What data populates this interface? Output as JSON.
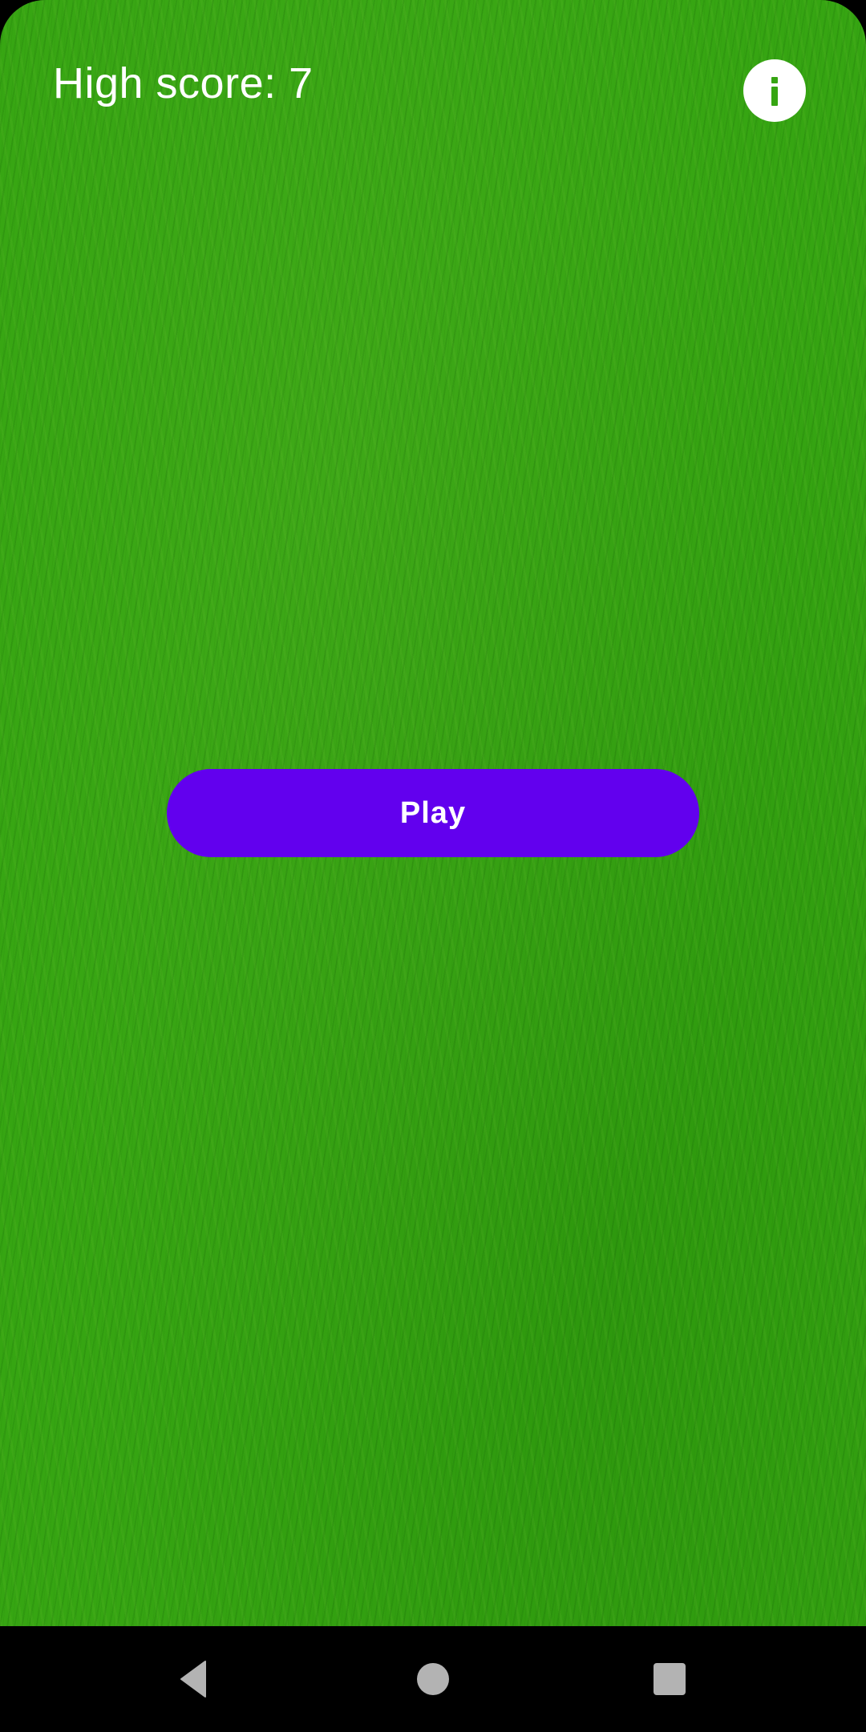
{
  "game": {
    "high_score_text": "High score: 7",
    "high_score_value": 7,
    "play_label": "Play",
    "info_icon": "info-icon"
  },
  "colors": {
    "grass": "#36a512",
    "play_button": "#6200ee",
    "text": "#ffffff",
    "nav_bar": "#000000",
    "nav_icon": "#b3b3b3"
  },
  "nav": {
    "back_icon": "back-triangle-icon",
    "home_icon": "home-circle-icon",
    "recents_icon": "recents-square-icon"
  }
}
